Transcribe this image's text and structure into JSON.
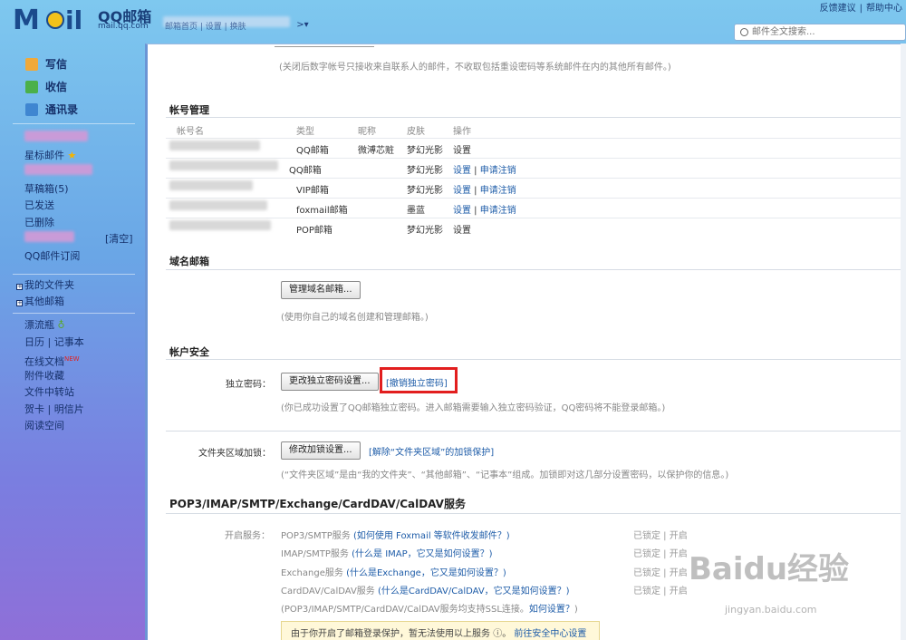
{
  "header": {
    "logo_text": "MOil",
    "brand": "QQ邮箱",
    "brand_sub": "mail.qq.com",
    "nav": [
      "邮箱首页",
      "设置",
      "换肤"
    ],
    "right_links": [
      "反馈建议",
      "帮助中心"
    ],
    "search_placeholder": "邮件全文搜索..."
  },
  "sidebar": {
    "main": [
      {
        "label": "写信",
        "icon": "pencil-icon"
      },
      {
        "label": "收信",
        "icon": "inbox-icon"
      },
      {
        "label": "通讯录",
        "icon": "contacts-icon"
      }
    ],
    "starred": "星标邮件",
    "folders": [
      "草稿箱(5)",
      "已发送",
      "已删除"
    ],
    "clear": "[清空]",
    "subscribe": "QQ邮件订阅",
    "my_folders": "我的文件夹",
    "other_mail": "其他邮箱",
    "apps": [
      "漂流瓶",
      "日历",
      "记事本",
      "在线文档",
      "附件收藏",
      "文件中转站",
      "贺卡",
      "明信片",
      "阅读空间"
    ],
    "new_badge": "NEW"
  },
  "main": {
    "top_note": "(关闭后数字帐号只接收来自联系人的邮件，不收取包括重设密码等系统邮件在内的其他所有邮件。)",
    "account_section": "帐号管理",
    "account_headers": [
      "帐号名",
      "类型",
      "昵称",
      "皮肤",
      "操作"
    ],
    "accounts": [
      {
        "type": "QQ邮箱",
        "nick": "微溥芯赃",
        "skin": "梦幻光影",
        "ops": [
          "设置"
        ]
      },
      {
        "type": "QQ邮箱",
        "nick": "",
        "skin": "梦幻光影",
        "ops": [
          "设置",
          "申请注销"
        ]
      },
      {
        "type": "VIP邮箱",
        "nick": "",
        "skin": "梦幻光影",
        "ops": [
          "设置",
          "申请注销"
        ]
      },
      {
        "type": "foxmail邮箱",
        "nick": "",
        "skin": "墨蓝",
        "ops": [
          "设置",
          "申请注销"
        ]
      },
      {
        "type": "POP邮箱",
        "nick": "",
        "skin": "梦幻光影",
        "ops": [
          "设置"
        ]
      }
    ],
    "domain_section": "域名邮箱",
    "domain_button": "管理域名邮箱...",
    "domain_note": "(使用你自己的域名创建和管理邮箱。)",
    "security_section": "帐户安全",
    "pwd_label": "独立密码：",
    "pwd_button": "更改独立密码设置...",
    "pwd_revoke": "[撤销独立密码]",
    "pwd_note": "(你已成功设置了QQ邮箱独立密码。进入邮箱需要输入独立密码验证，QQ密码将不能登录邮箱。)",
    "folder_label": "文件夹区域加锁：",
    "folder_button": "修改加锁设置...",
    "folder_link": "[解除“文件夹区域”的加锁保护]",
    "folder_note": "(“文件夹区域”是由“我的文件夹”、“其他邮箱”、“记事本”组成。加锁即对这几部分设置密码，以保护你的信息。)",
    "pop_section": "POP3/IMAP/SMTP/Exchange/CardDAV/CalDAV服务",
    "service_label": "开启服务：",
    "services": [
      {
        "name": "POP3/SMTP服务",
        "help": "(如何使用 Foxmail 等软件收发邮件？)",
        "status": "已锁定",
        "action": "开启"
      },
      {
        "name": "IMAP/SMTP服务",
        "help": "(什么是 IMAP，它又是如何设置？)",
        "status": "已锁定",
        "action": "开启"
      },
      {
        "name": "Exchange服务",
        "help": "(什么是Exchange，它又是如何设置？)",
        "status": "已锁定",
        "action": "开启"
      },
      {
        "name": "CardDAV/CalDAV服务",
        "help": "(什么是CardDAV/CalDAV，它又是如何设置？)",
        "status": "已锁定",
        "action": "开启"
      }
    ],
    "ssl_note": "(POP3/IMAP/SMTP/CardDAV/CalDAV服务均支持SSL连接。",
    "ssl_link": "如何设置？",
    "ssl_end": ")",
    "warning": "由于你开启了邮箱登录保护，暂无法使用以上服务",
    "warning_link": "前往安全中心设置"
  },
  "watermark": {
    "text": "Baidu经验",
    "sub": "jingyan.baidu.com"
  }
}
